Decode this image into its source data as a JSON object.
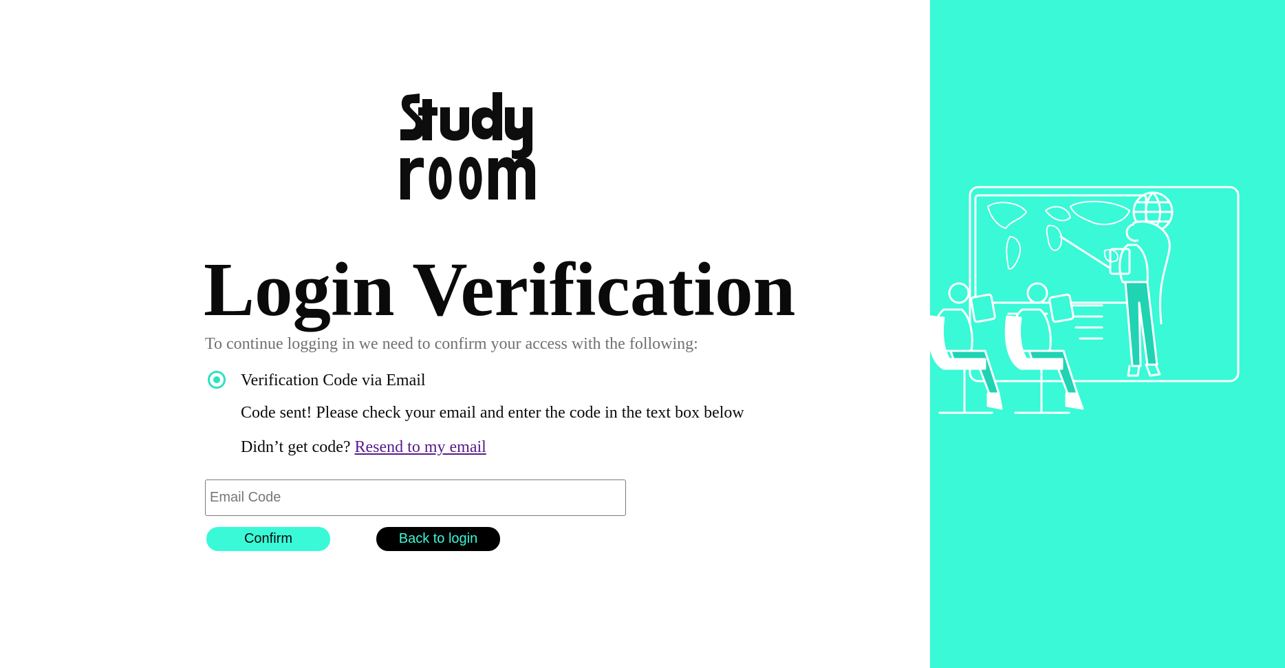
{
  "brand": {
    "logo_text": "Study room",
    "accent_color": "#39f9d7",
    "logo_icon": "studyroom-logo-icon"
  },
  "page": {
    "title": "Login Verification",
    "subtitle": "To continue logging in we need to confirm your access with the following:"
  },
  "verification": {
    "option_label": "Verification Code via Email",
    "option_selected": true,
    "sent_message": "Code sent! Please check your email and enter the code in the text box below",
    "resend_prompt": "Didn’t get code?",
    "resend_link": "Resend to my email"
  },
  "form": {
    "code_placeholder": "Email Code",
    "code_value": "",
    "confirm_label": "Confirm",
    "back_label": "Back to login"
  },
  "illustration": {
    "icon": "classroom-illustration-icon"
  }
}
